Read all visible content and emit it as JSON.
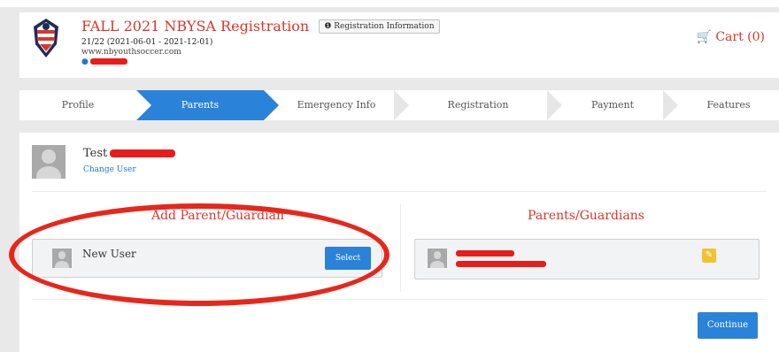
{
  "header": {
    "title": "FALL 2021 NBYSA Registration",
    "reg_info_button": "Registration Information",
    "season": "21/22 (2021-06-01 - 2021-12-01)",
    "website": "www.nbyouthsoccer.com",
    "cart_label": "Cart (0)"
  },
  "wizard": {
    "steps": [
      {
        "label": "Profile"
      },
      {
        "label": "Parents"
      },
      {
        "label": "Emergency Info"
      },
      {
        "label": "Registration"
      },
      {
        "label": "Payment"
      },
      {
        "label": "Features"
      }
    ],
    "active_index": 1
  },
  "current_user": {
    "first_name": "Test",
    "change_user_label": "Change User"
  },
  "add_parent": {
    "heading": "Add Parent/Guardian",
    "new_user_label": "New User",
    "select_button": "Select"
  },
  "parents": {
    "heading": "Parents/Guardians"
  },
  "continue_button": "Continue",
  "colors": {
    "brand_red": "#d9362b",
    "primary_blue": "#2b82d9",
    "edit_yellow": "#f1c232",
    "annotation_red": "#e8261a"
  }
}
